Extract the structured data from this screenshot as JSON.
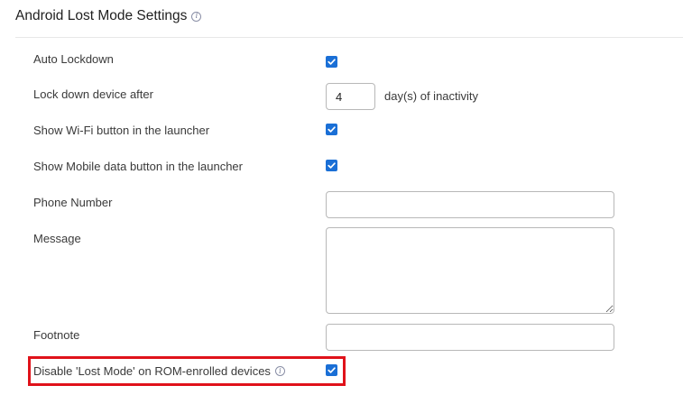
{
  "section": {
    "title": "Android Lost Mode Settings"
  },
  "fields": {
    "auto_lockdown": {
      "label": "Auto Lockdown",
      "checked": true
    },
    "lock_down_after": {
      "label": "Lock down device after",
      "value": "4",
      "suffix": "day(s) of inactivity"
    },
    "show_wifi": {
      "label": "Show Wi-Fi button in the launcher",
      "checked": true
    },
    "show_mobile_data": {
      "label": "Show Mobile data button in the launcher",
      "checked": true
    },
    "phone_number": {
      "label": "Phone Number",
      "value": ""
    },
    "message": {
      "label": "Message",
      "value": ""
    },
    "footnote": {
      "label": "Footnote",
      "value": ""
    },
    "disable_lost_mode": {
      "label": "Disable 'Lost Mode' on ROM-enrolled devices",
      "checked": true
    }
  },
  "colors": {
    "checkbox_accent": "#1a6fd6",
    "highlight_border": "#e0121a"
  }
}
